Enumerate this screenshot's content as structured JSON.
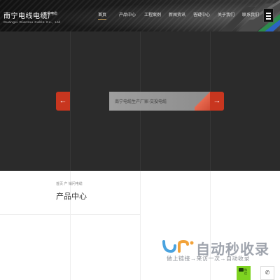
{
  "header": {
    "logo_title": "南宁电线电缆厂",
    "logo_subtitle": "交投电缆",
    "logo_english": "Guangxi Diantou Cable Co., Ltd"
  },
  "nav": {
    "items": [
      {
        "label": "首页"
      },
      {
        "label": "产品中心"
      },
      {
        "label": "工程案例"
      },
      {
        "label": "新闻资讯"
      },
      {
        "label": "答疑中心"
      },
      {
        "label": "关于我们"
      },
      {
        "label": "联系我们"
      }
    ],
    "active_index": 0,
    "menu_icon": "hamburger-menu-icon"
  },
  "banner": {
    "prev_icon": "arrow-left-icon",
    "next_icon": "arrow-right-icon",
    "prev_symbol": "←",
    "next_symbol": "→",
    "caption": "南宁电缆生产厂家-交投电缆"
  },
  "content": {
    "breadcrumb": "首页 产 销问电缆",
    "section_title": "产品中心"
  },
  "watermark": {
    "title": "自动秒收录",
    "slogan": "做上链接→来访一次→自动收录"
  },
  "floating": {
    "chat_label_line1": "微",
    "chat_label_line2": "信",
    "phone_symbol": "✆"
  },
  "colors": {
    "accent_red": "#c8361f",
    "nav_underline": "#c9a15b",
    "chat_green": "#7ed321"
  }
}
